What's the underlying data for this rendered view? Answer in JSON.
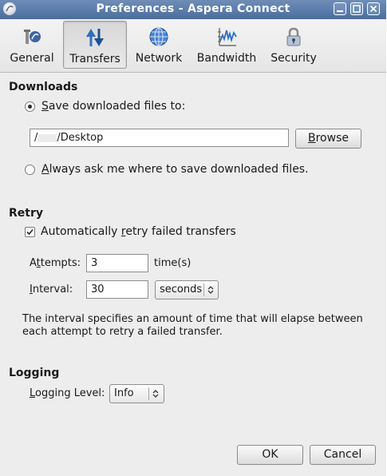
{
  "window": {
    "title": "Preferences - Aspera Connect"
  },
  "titlebar_buttons": [
    "minimize",
    "maximize",
    "close"
  ],
  "tabs": [
    {
      "label": "General",
      "icon": "general-icon",
      "selected": false
    },
    {
      "label": "Transfers",
      "icon": "transfers-icon",
      "selected": true
    },
    {
      "label": "Network",
      "icon": "network-globe-icon",
      "selected": false
    },
    {
      "label": "Bandwidth",
      "icon": "bandwidth-icon",
      "selected": false
    },
    {
      "label": "Security",
      "icon": "security-lock-icon",
      "selected": false
    }
  ],
  "downloads": {
    "heading": "Downloads",
    "save_option": {
      "label_first": "S",
      "label_rest": "ave downloaded files to:",
      "selected": true
    },
    "path_prefix": "/",
    "path_suffix": "/Desktop",
    "browse_label_first": "B",
    "browse_label_rest": "rowse",
    "ask_option": {
      "label_first": "A",
      "label_rest": "lways ask me where to save downloaded files.",
      "selected": false
    }
  },
  "retry": {
    "heading": "Retry",
    "auto_retry_before": "Automatically ",
    "auto_retry_mnemonic": "r",
    "auto_retry_after": "etry failed transfers",
    "auto_retry_checked": true,
    "attempts_label_a": "A",
    "attempts_label_b": "t",
    "attempts_label_c": "tempts:",
    "attempts_value": "3",
    "attempts_unit": "time(s)",
    "interval_label_first": "I",
    "interval_label_rest": "nterval:",
    "interval_value": "30",
    "interval_unit": "seconds",
    "description_line1": "The interval specifies an amount of time that will elapse between",
    "description_line2": "each attempt to retry a failed transfer."
  },
  "logging": {
    "heading": "Logging",
    "level_label_first": "L",
    "level_label_rest": "ogging Level:",
    "level_value": "Info"
  },
  "footer": {
    "ok_label": "OK",
    "cancel_label": "Cancel"
  },
  "colors": {
    "titlebar": "#5a7aa8",
    "window_bg": "#ededed",
    "text": "#1a1a1a"
  }
}
